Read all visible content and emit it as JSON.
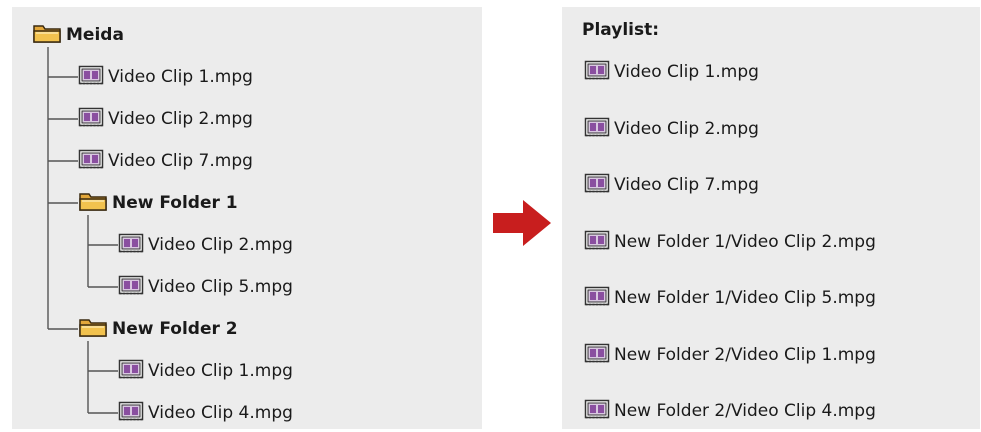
{
  "tree": {
    "root": {
      "label": "Meida",
      "icon": "folder-icon"
    },
    "items": [
      {
        "label": "Video Clip 1.mpg",
        "icon": "video-clip-icon",
        "type": "file"
      },
      {
        "label": "Video Clip 2.mpg",
        "icon": "video-clip-icon",
        "type": "file"
      },
      {
        "label": "Video Clip 7.mpg",
        "icon": "video-clip-icon",
        "type": "file"
      },
      {
        "label": "New Folder 1",
        "icon": "folder-icon",
        "type": "folder",
        "children": [
          {
            "label": "Video Clip 2.mpg",
            "icon": "video-clip-icon",
            "type": "file"
          },
          {
            "label": "Video Clip 5.mpg",
            "icon": "video-clip-icon",
            "type": "file"
          }
        ]
      },
      {
        "label": "New Folder 2",
        "icon": "folder-icon",
        "type": "folder",
        "children": [
          {
            "label": "Video Clip 1.mpg",
            "icon": "video-clip-icon",
            "type": "file"
          },
          {
            "label": "Video Clip 4.mpg",
            "icon": "video-clip-icon",
            "type": "file"
          }
        ]
      }
    ]
  },
  "arrow": {
    "icon": "right-arrow-icon",
    "color": "#c81e1e"
  },
  "playlist": {
    "title": "Playlist:",
    "items": [
      {
        "label": "Video Clip 1.mpg",
        "icon": "video-clip-icon"
      },
      {
        "label": "Video Clip 2.mpg",
        "icon": "video-clip-icon"
      },
      {
        "label": "Video Clip 7.mpg",
        "icon": "video-clip-icon"
      },
      {
        "label": "New Folder 1/Video Clip 2.mpg",
        "icon": "video-clip-icon"
      },
      {
        "label": "New Folder 1/Video Clip 5.mpg",
        "icon": "video-clip-icon"
      },
      {
        "label": "New Folder 2/Video Clip 1.mpg",
        "icon": "video-clip-icon"
      },
      {
        "label": "New Folder 2/Video Clip 4.mpg",
        "icon": "video-clip-icon"
      }
    ]
  },
  "colors": {
    "panel_background": "#ececec",
    "folder": "#f2c24e",
    "video_clip": "#8a4fa0",
    "tree_lines": "#555555"
  }
}
